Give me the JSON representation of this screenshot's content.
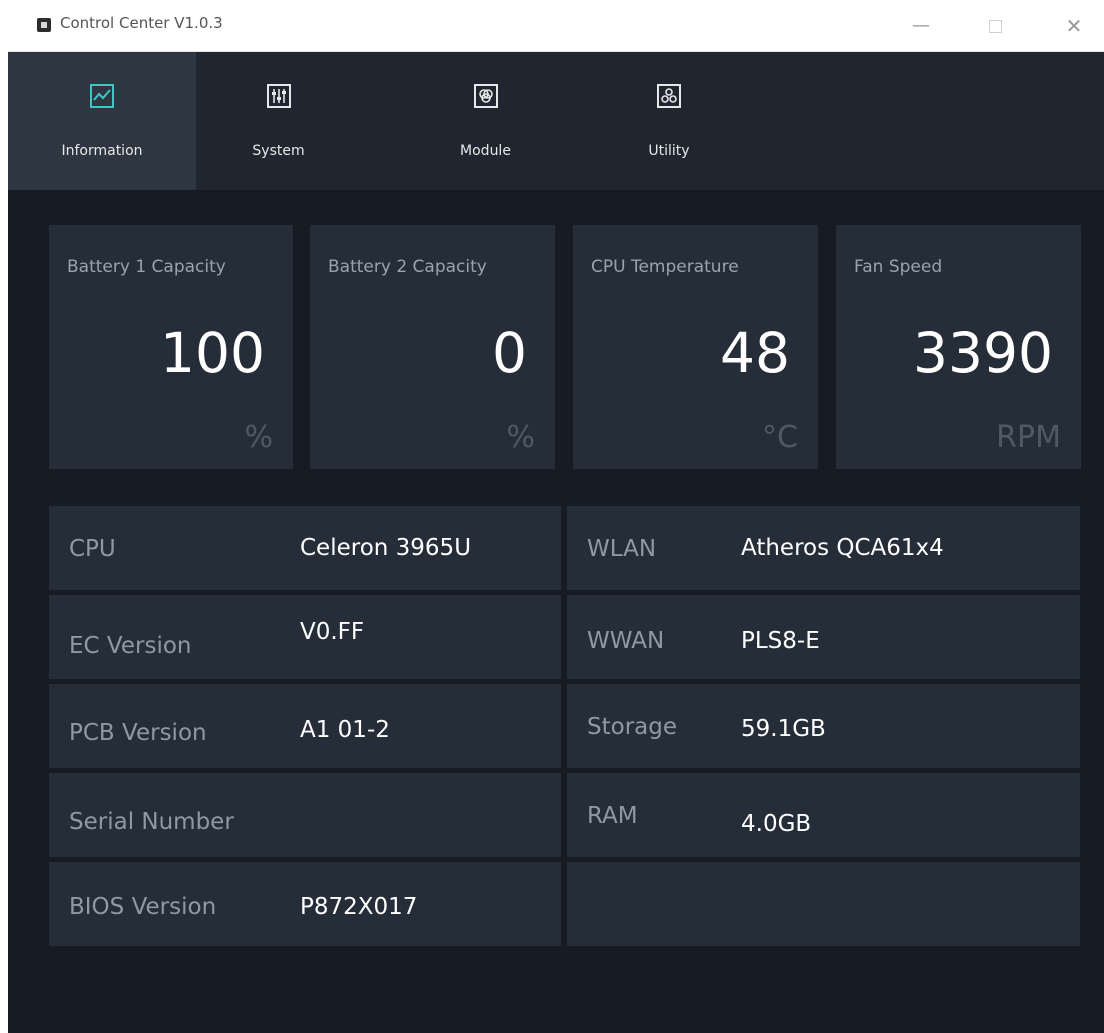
{
  "window": {
    "title": "Control Center V1.0.3",
    "controls": {
      "minimize": "—",
      "maximize": "",
      "close": "✕"
    }
  },
  "tabs": [
    {
      "label": "Information",
      "icon": "line-chart-icon",
      "active": true
    },
    {
      "label": "System",
      "icon": "sliders-icon"
    },
    {
      "label": "Module",
      "icon": "module-icon"
    },
    {
      "label": "Utility",
      "icon": "utility-icon"
    }
  ],
  "cards": [
    {
      "title": "Battery 1 Capacity",
      "value": "100",
      "unit": "%"
    },
    {
      "title": "Battery 2 Capacity",
      "value": "0",
      "unit": "%"
    },
    {
      "title": "CPU Temperature",
      "value": "48",
      "unit": "°C"
    },
    {
      "title": "Fan Speed",
      "value": "3390",
      "unit": "RPM"
    }
  ],
  "left_rows": [
    {
      "label": "CPU",
      "value": "Celeron 3965U"
    },
    {
      "label": "EC Version",
      "value": "V0.FF"
    },
    {
      "label": "PCB Version",
      "value": "A1 01-2"
    },
    {
      "label": "Serial Number",
      "value": ""
    },
    {
      "label": "BIOS Version",
      "value": "P872X017"
    }
  ],
  "right_rows": [
    {
      "label": "WLAN",
      "value": "Atheros QCA61x4"
    },
    {
      "label": "WWAN",
      "value": "PLS8-E"
    },
    {
      "label": "Storage",
      "value": "59.1GB"
    },
    {
      "label": "RAM",
      "value": "4.0GB"
    }
  ],
  "colors": {
    "accent": "#3ec6c6",
    "background": "#171c24",
    "panel": "#252d38"
  }
}
